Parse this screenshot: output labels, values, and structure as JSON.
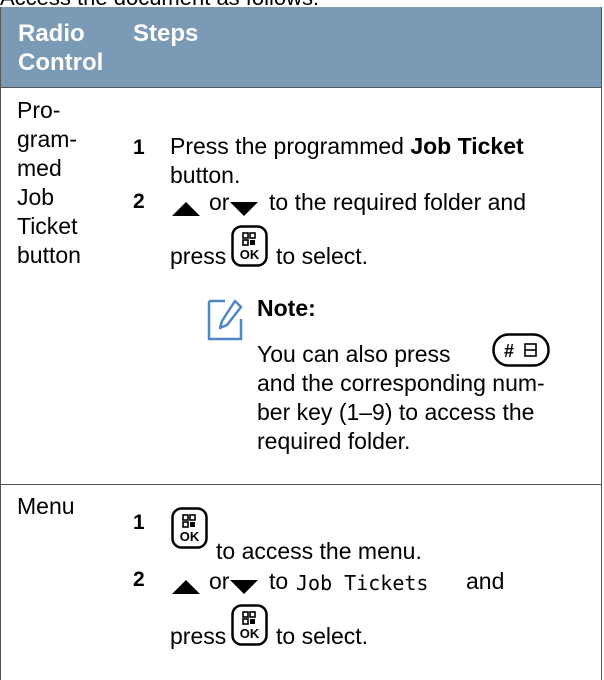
{
  "top_fragment": "Access the document as follows:",
  "table": {
    "headers": {
      "radio_control": "Radio Control",
      "steps": "Steps"
    },
    "rows": [
      {
        "label": [
          "Pro-",
          "gram-",
          "med",
          "Job",
          "Ticket",
          "button"
        ],
        "steps": [
          {
            "num": "1",
            "text_pre": "Press the programmed ",
            "bold": "Job Ticket",
            "line2": "button."
          },
          {
            "num": "2",
            "line1_mid": "or",
            "line1_post": "to the required folder and",
            "line2_pre": "press",
            "line2_post": "to select."
          }
        ],
        "note": {
          "title": "Note:",
          "line1": "You can also press",
          "lines": [
            "and the corresponding num-",
            "ber key (1–9) to access the",
            "required folder."
          ]
        }
      },
      {
        "label": [
          "Menu"
        ],
        "steps": [
          {
            "num": "1",
            "text": "to access the menu."
          },
          {
            "num": "2",
            "line1_mid": "or",
            "line1_to": "to",
            "menu_item": "Job Tickets",
            "line1_post": "and",
            "line2_pre": "press",
            "line2_post": "to select."
          }
        ]
      }
    ]
  },
  "keys": {
    "ok_top": "▦",
    "ok_bottom": "OK",
    "hash_left": "#",
    "hash_right": "⌂"
  },
  "icons": {
    "up": "up-triangle-icon",
    "down": "down-triangle-icon",
    "ok": "ok-key-icon",
    "hash": "hash-key-icon",
    "note": "note-pencil-icon"
  },
  "colors": {
    "header_bg": "#7a9ab6",
    "icon_blue": "#4f86c6"
  }
}
